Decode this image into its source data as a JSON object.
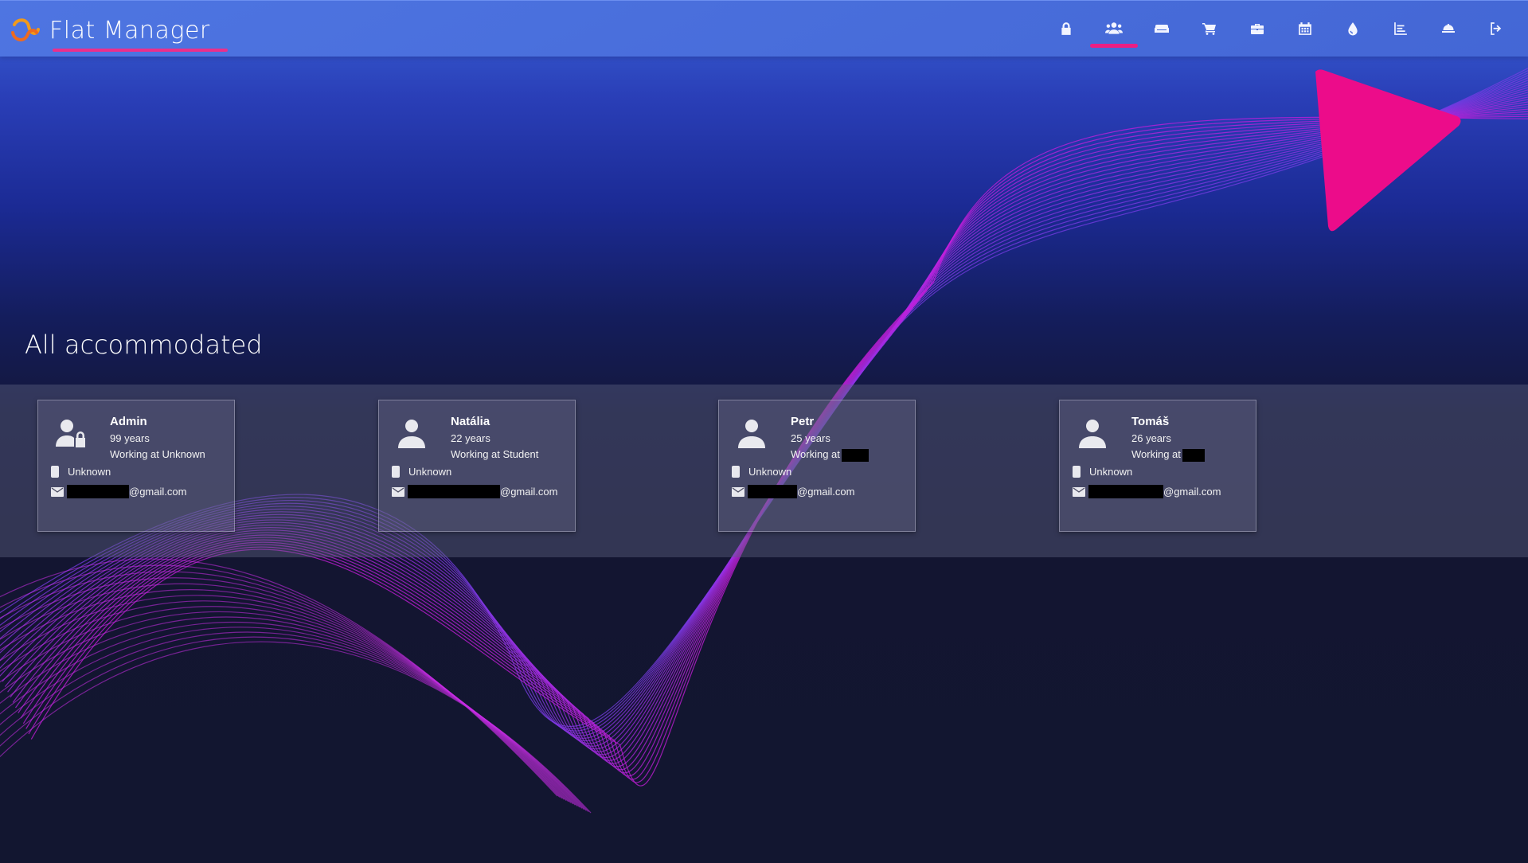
{
  "app": {
    "title": "Flat Manager"
  },
  "nav": {
    "items": [
      {
        "name": "lock",
        "icon": "lock-icon",
        "active": false
      },
      {
        "name": "accommodated",
        "icon": "users-icon",
        "active": true
      },
      {
        "name": "furniture",
        "icon": "couch-icon",
        "active": false
      },
      {
        "name": "shopping",
        "icon": "cart-icon",
        "active": false
      },
      {
        "name": "work",
        "icon": "briefcase-icon",
        "active": false
      },
      {
        "name": "calendar",
        "icon": "calendar-icon",
        "active": false
      },
      {
        "name": "water",
        "icon": "drop-icon",
        "active": false
      },
      {
        "name": "stats",
        "icon": "chart-icon",
        "active": false
      },
      {
        "name": "services",
        "icon": "bell-icon",
        "active": false
      },
      {
        "name": "logout",
        "icon": "logout-icon",
        "active": false
      }
    ]
  },
  "main": {
    "title": "All accommodated",
    "residents": [
      {
        "name": "Admin",
        "age": "99 years",
        "work": "Working at Unknown",
        "phone": "Unknown",
        "email_domain": "@gmail.com",
        "avatar_icon": "user-lock-icon"
      },
      {
        "name": "Natália",
        "age": "22 years",
        "work": "Working at Student",
        "phone": "Unknown",
        "email_domain": "@gmail.com",
        "avatar_icon": "user-icon"
      },
      {
        "name": "Petr",
        "age": "25 years",
        "work": "Working at",
        "phone": "Unknown",
        "email_domain": "@gmail.com",
        "avatar_icon": "user-icon"
      },
      {
        "name": "Tomáš",
        "age": "26 years",
        "work": "Working at",
        "phone": "Unknown",
        "email_domain": "@gmail.com",
        "avatar_icon": "user-icon"
      }
    ]
  },
  "colors": {
    "accent": "#ec1e83",
    "topbar": "#4f76e2",
    "wave": "#c52ee8"
  }
}
